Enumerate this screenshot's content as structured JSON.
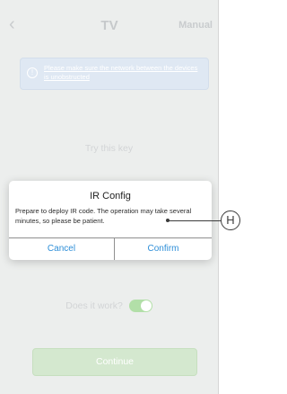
{
  "header": {
    "back_icon": "chevron-left-icon",
    "back_glyph": "‹",
    "title": "TV",
    "manual_label": "Manual"
  },
  "info_banner": {
    "icon": "info-icon",
    "icon_glyph": "!",
    "text": "Please make sure the network between the devices is unobstructed"
  },
  "main": {
    "try_key_label": "Try this key",
    "works_label": "Does it work?",
    "works_toggle_on": true,
    "continue_label": "Continue"
  },
  "dialog": {
    "title": "IR Config",
    "message": "Prepare to deploy IR code. The operation may take several minutes, so please be patient.",
    "cancel_label": "Cancel",
    "confirm_label": "Confirm"
  },
  "callout": {
    "label": "H"
  },
  "colors": {
    "accent_blue": "#2f8fd8",
    "toggle_green": "#b2dfa8",
    "continue_green": "#d4e8cf"
  }
}
